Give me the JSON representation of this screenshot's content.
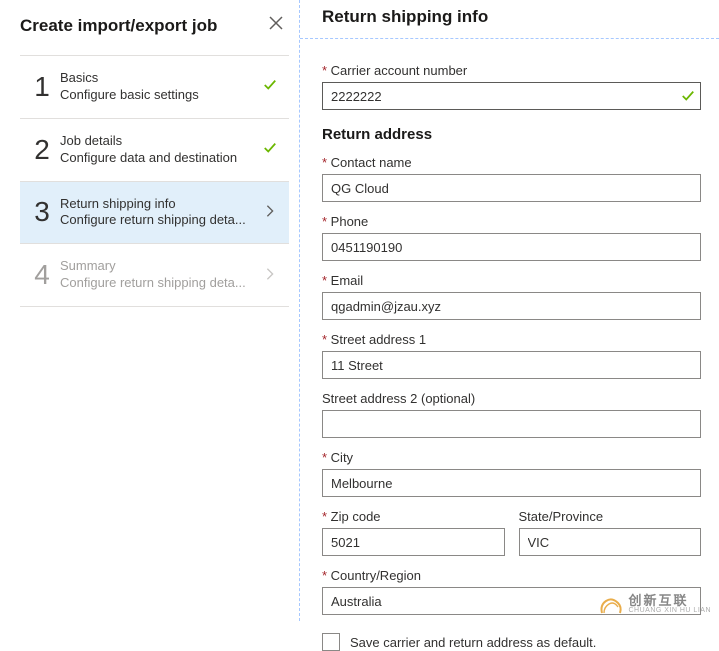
{
  "left": {
    "title": "Create import/export job",
    "steps": [
      {
        "num": "1",
        "title": "Basics",
        "sub": "Configure basic settings",
        "state": "done"
      },
      {
        "num": "2",
        "title": "Job details",
        "sub": "Configure data and destination",
        "state": "done"
      },
      {
        "num": "3",
        "title": "Return shipping info",
        "sub": "Configure return shipping deta...",
        "state": "active"
      },
      {
        "num": "4",
        "title": "Summary",
        "sub": "Configure return shipping deta...",
        "state": "disabled"
      }
    ]
  },
  "right": {
    "title": "Return shipping info",
    "carrier_label": "Carrier account number",
    "carrier_value": "2222222",
    "return_address_head": "Return address",
    "contact_label": "Contact name",
    "contact_value": "QG Cloud",
    "phone_label": "Phone",
    "phone_value": "0451190190",
    "email_label": "Email",
    "email_value": "qgadmin@jzau.xyz",
    "street1_label": "Street address 1",
    "street1_value": "11 Street",
    "street2_label": "Street address 2 (optional)",
    "street2_value": "",
    "city_label": "City",
    "city_value": "Melbourne",
    "zip_label": "Zip code",
    "zip_value": "5021",
    "state_label": "State/Province",
    "state_value": "VIC",
    "country_label": "Country/Region",
    "country_value": "Australia",
    "save_default_label": "Save carrier and return address as default."
  },
  "watermark": {
    "zh": "创新互联",
    "en": "CHUANG XIN HU LIAN"
  }
}
